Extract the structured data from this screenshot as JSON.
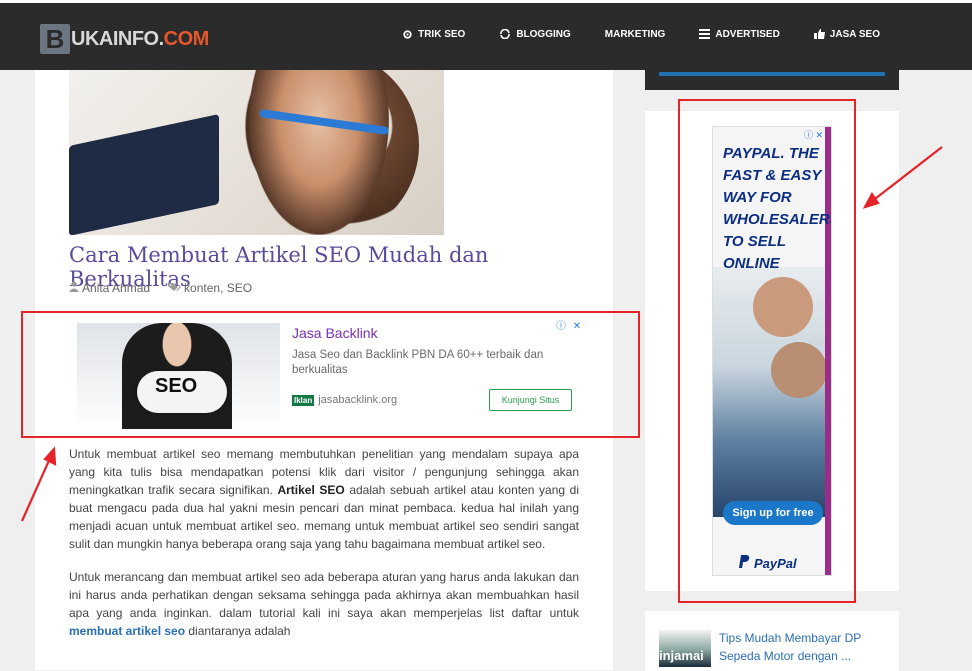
{
  "brand": {
    "logo_letter": "B",
    "logo_text": "UKAINFO.",
    "logo_com": "COM"
  },
  "nav": [
    {
      "label": "TRIK SEO",
      "icon": "gear-icon"
    },
    {
      "label": "BLOGGING",
      "icon": "refresh-icon"
    },
    {
      "label": "MARKETING",
      "icon": ""
    },
    {
      "label": "ADVERTISED",
      "icon": "list-icon"
    },
    {
      "label": "JASA SEO",
      "icon": "thumbs-up-icon"
    }
  ],
  "post": {
    "title": "Cara Membuat Artikel SEO Mudah dan Berkualitas",
    "author": "Anita Ahmad",
    "tags": "konten, SEO",
    "p1_a": "Untuk membuat artikel seo memang membutuhkan penelitian yang mendalam supaya apa yang kita tulis bisa mendapatkan potensi klik dari visitor / pengunjung sehingga akan meningkatkan trafik secara signifikan. ",
    "p1_bold": "Artikel SEO",
    "p1_b": " adalah sebuah artikel atau konten yang di buat mengacu pada dua hal yakni mesin pencari dan minat pembaca. kedua hal inilah yang menjadi acuan untuk membuat artikel seo. memang untuk membuat artikel seo sendiri sangat sulit dan mungkin hanya beberapa orang saja yang tahu bagaimana membuat artikel seo.",
    "p2_a": "Untuk merancang dan membuat artikel seo ada beberapa aturan yang harus anda lakukan dan ini harus anda perhatikan dengan seksama sehingga pada akhirnya akan membuahkan hasil apa yang anda inginkan. dalam tutorial kali ini saya akan memperjelas list daftar untuk ",
    "p2_link": "membuat artikel seo",
    "p2_b": " diantaranya adalah"
  },
  "ad_inline": {
    "image_text": "SEO",
    "title": "Jasa Backlink",
    "desc": "Jasa Seo dan Backlink PBN DA 60++ terbaik dan berkualitas",
    "badge": "Iklan",
    "domain": "jasabacklink.org",
    "cta": "Kunjungi Situs",
    "close": "ⓘ ✕"
  },
  "ad_sidebar": {
    "headline": "PAYPAL. THE FAST & EASY WAY FOR WHOLESALERS TO SELL ONLINE",
    "signup": "Sign up for free",
    "brand": "PayPal",
    "close": "ⓘ ✕"
  },
  "related": {
    "thumb_text": "injamai",
    "title": "Tips Mudah Membayar DP Sepeda Motor dengan ..."
  },
  "colors": {
    "highlight": "#e5242a",
    "title": "#5a4a9a",
    "link": "#2a6fb5"
  }
}
